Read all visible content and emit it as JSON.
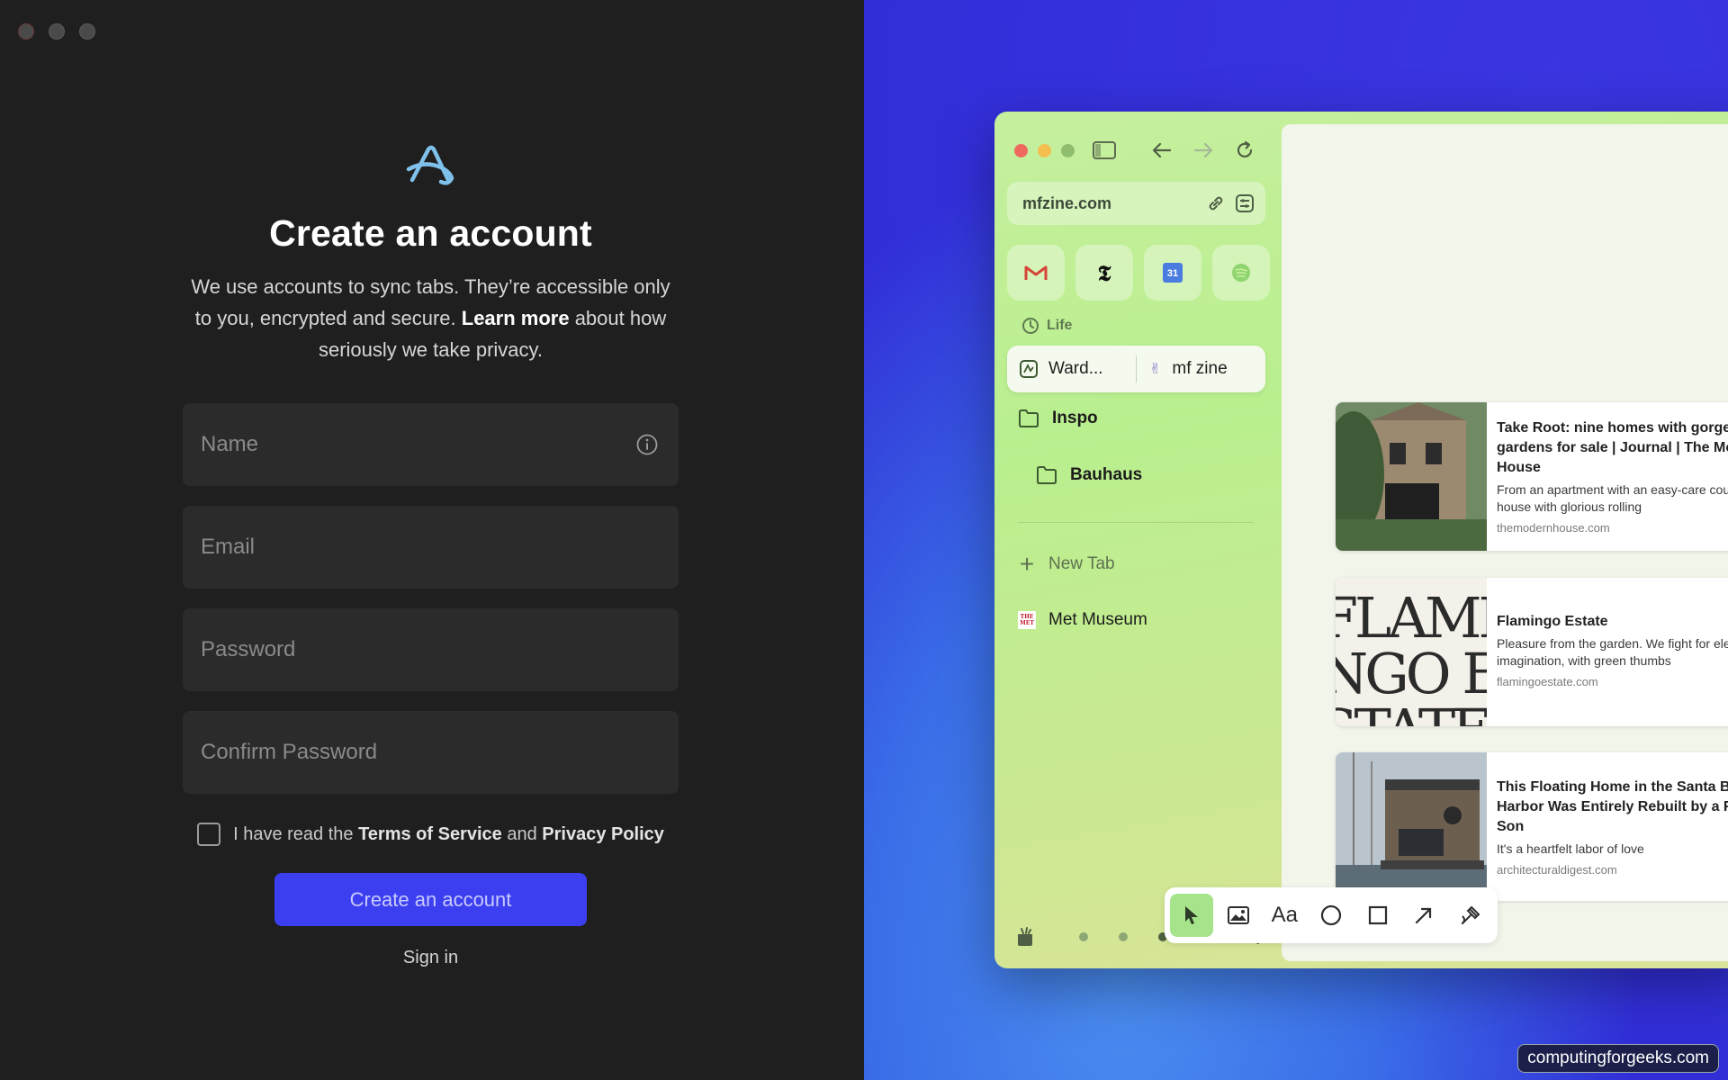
{
  "window": {
    "controls": [
      "close",
      "minimize",
      "zoom"
    ]
  },
  "signup": {
    "logo_icon": "arc-logo-icon",
    "title": "Create an account",
    "subtitle_part1": "We use accounts to sync tabs. They’re accessible only to you, encrypted and secure. ",
    "subtitle_link": "Learn more",
    "subtitle_part2": " about how seriously we take privacy.",
    "fields": {
      "name_placeholder": "Name",
      "email_placeholder": "Email",
      "password_placeholder": "Password",
      "confirm_placeholder": "Confirm Password"
    },
    "terms_prefix": "I have read the ",
    "terms_link": "Terms of Service",
    "terms_and": " and ",
    "privacy_link": "Privacy Policy",
    "terms_checked": false,
    "create_button": "Create an account",
    "signin_link": "Sign in"
  },
  "browser_preview": {
    "url": "mfzine.com",
    "favorites": [
      "gmail-icon",
      "nytimes-icon",
      "calendar-icon",
      "spotify-icon"
    ],
    "calendar_day": "31",
    "nyt_glyph": "𝕿",
    "space_label": "Life",
    "split_tab_left": "Ward...",
    "split_tab_right": "mf zine",
    "folders": [
      "Inspo",
      "Bauhaus"
    ],
    "new_tab": "New Tab",
    "met_tab": "Met Museum",
    "met_glyph": "THE MET",
    "cards": [
      {
        "title": "Take Root: nine homes with gorgeous gardens for sale | Journal | The Modern House",
        "desc": "From an apartment with an easy-care courtyard to house with glorious rolling",
        "source": "themodernhouse.com"
      },
      {
        "title": "Flamingo Estate",
        "desc": "Pleasure from the garden. We fight for elegance and imagination, with green thumbs",
        "source": "flamingoestate.com",
        "thumb_text": "FLAMINGO ESTATE"
      },
      {
        "title": "This Floating Home in the Santa Barbara Harbor Was Entirely Rebuilt by a Father and Son",
        "desc": "It's a heartfelt labor of love",
        "source": "architecturaldigest.com"
      }
    ],
    "tools": [
      "cursor-tool",
      "image-tool",
      "text-tool",
      "circle-tool",
      "square-tool",
      "arrow-tool",
      "pen-tool"
    ],
    "text_tool_label": "Aa"
  },
  "colors": {
    "accent": "#3b3ff0",
    "browser_bg": "#c6ef9e",
    "right_bg": "#3532dd"
  },
  "watermark": "computingforgeeks.com"
}
